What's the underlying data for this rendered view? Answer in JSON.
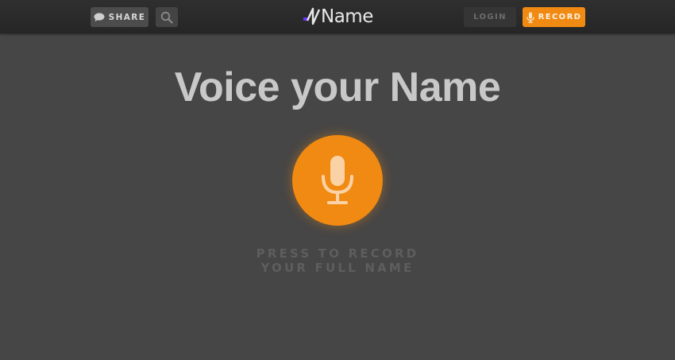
{
  "header": {
    "share_label": "SHARE",
    "logo_text": "Name",
    "login_label": "LOGIN",
    "record_label": "RECORD"
  },
  "icons": {
    "share": "speech-bubble-icon",
    "search": "search-icon",
    "record": "microphone-icon",
    "main": "microphone-icon"
  },
  "main": {
    "title": "Voice your Name",
    "prompt_line1": "PRESS TO RECORD",
    "prompt_line2": "YOUR FULL NAME"
  },
  "colors": {
    "accent": "#f18a12",
    "background": "#464646",
    "topbar": "#2a2a2a",
    "logo_dot": "#6a35ff"
  }
}
